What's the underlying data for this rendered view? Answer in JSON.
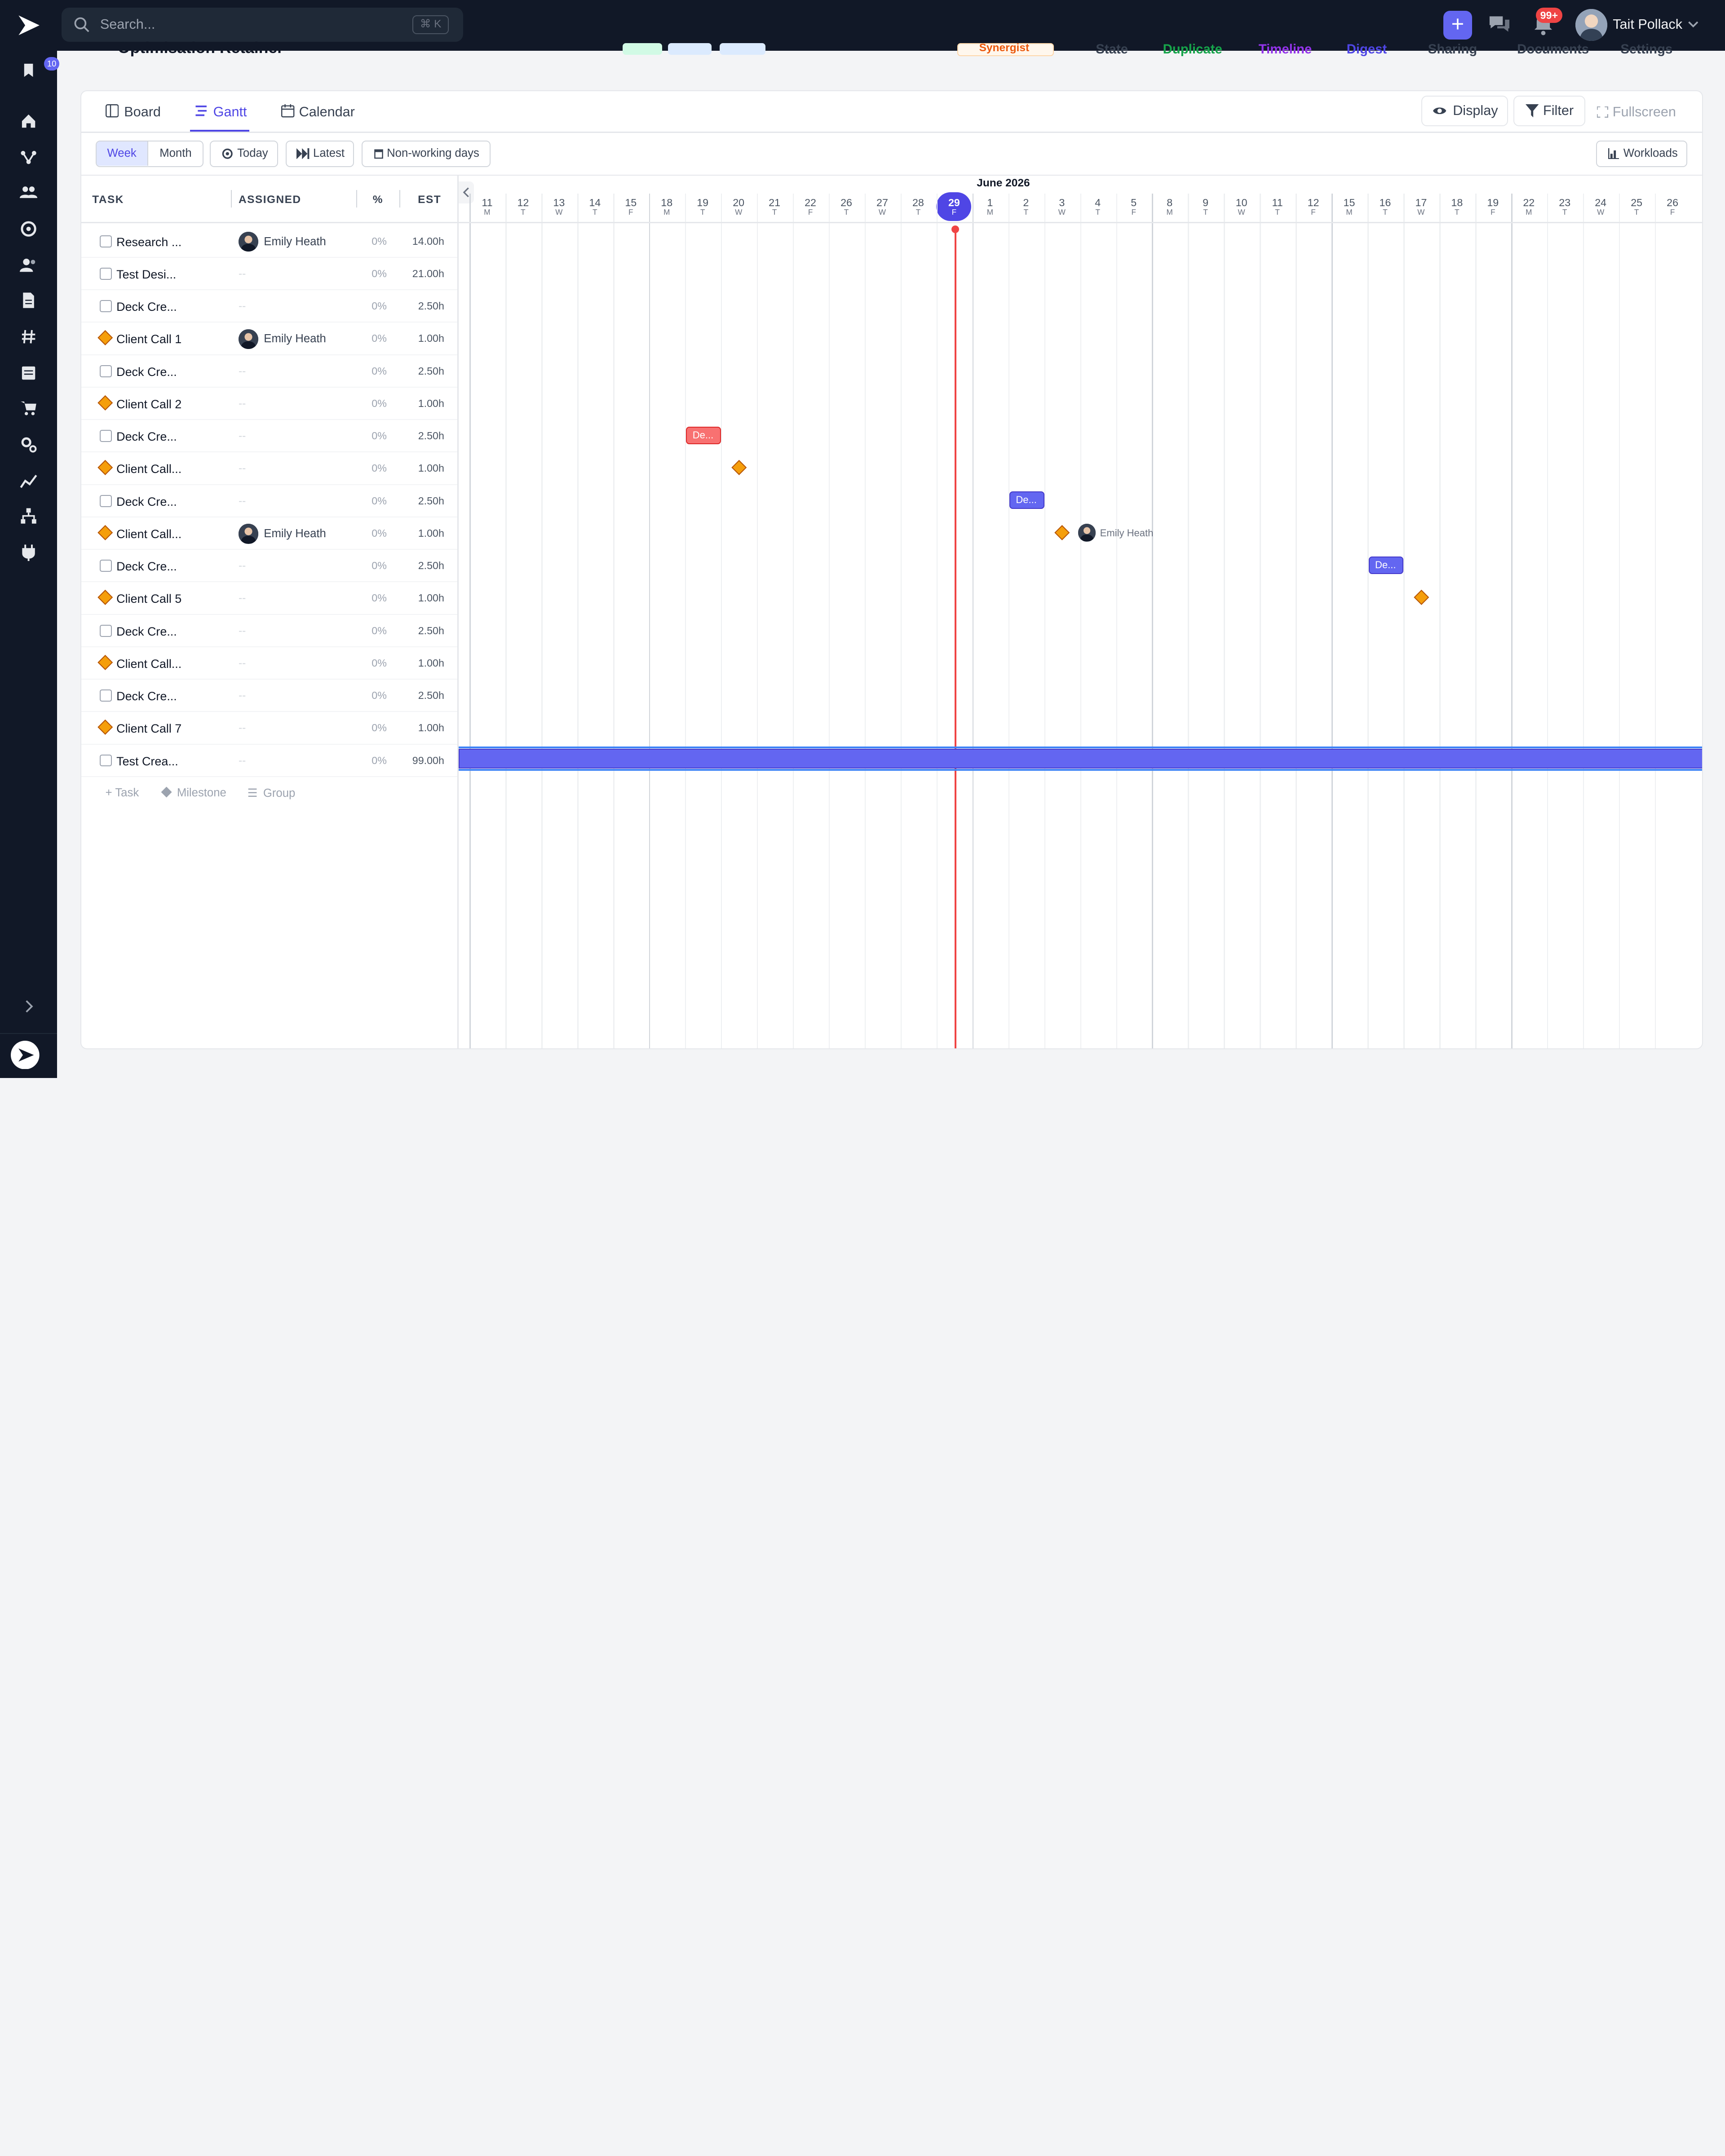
{
  "header": {
    "search_placeholder": "Search...",
    "search_shortcut": "⌘ K",
    "notification_count": "99+",
    "user_name": "Tait Pollack"
  },
  "sidebar": {
    "badge": "10"
  },
  "project": {
    "title": "Optimisation Retainer",
    "actions": [
      "State",
      "Duplicate",
      "Timeline",
      "Digest",
      "Sharing",
      "Documents",
      "Settings"
    ],
    "synergist": "Synergist"
  },
  "tabs": [
    "Board",
    "Gantt",
    "Calendar"
  ],
  "actions": {
    "display": "Display",
    "filter": "Filter",
    "fullscreen": "Fullscreen",
    "workloads": "Workloads"
  },
  "toolbar": {
    "week": "Week",
    "month": "Month",
    "today": "Today",
    "latest": "Latest",
    "nonworking": "Non-working days"
  },
  "columns": {
    "task": "TASK",
    "assigned": "ASSIGNED",
    "percent": "%",
    "est": "EST"
  },
  "tasks": [
    {
      "name": "Research ...",
      "type": "task",
      "assignee": "Emily Heath",
      "pct": "0%",
      "est": "14.00h"
    },
    {
      "name": "Test Desi...",
      "type": "task",
      "assignee": "--",
      "pct": "0%",
      "est": "21.00h"
    },
    {
      "name": "Deck Cre...",
      "type": "task",
      "assignee": "--",
      "pct": "0%",
      "est": "2.50h"
    },
    {
      "name": "Client Call 1",
      "type": "milestone",
      "assignee": "Emily Heath",
      "pct": "0%",
      "est": "1.00h"
    },
    {
      "name": "Deck Cre...",
      "type": "task",
      "assignee": "--",
      "pct": "0%",
      "est": "2.50h"
    },
    {
      "name": "Client Call 2",
      "type": "milestone",
      "assignee": "--",
      "pct": "0%",
      "est": "1.00h"
    },
    {
      "name": "Deck Cre...",
      "type": "task",
      "assignee": "--",
      "pct": "0%",
      "est": "2.50h"
    },
    {
      "name": "Client Call...",
      "type": "milestone",
      "assignee": "--",
      "pct": "0%",
      "est": "1.00h"
    },
    {
      "name": "Deck Cre...",
      "type": "task",
      "assignee": "--",
      "pct": "0%",
      "est": "2.50h"
    },
    {
      "name": "Client Call...",
      "type": "milestone",
      "assignee": "Emily Heath",
      "pct": "0%",
      "est": "1.00h"
    },
    {
      "name": "Deck Cre...",
      "type": "task",
      "assignee": "--",
      "pct": "0%",
      "est": "2.50h"
    },
    {
      "name": "Client Call 5",
      "type": "milestone",
      "assignee": "--",
      "pct": "0%",
      "est": "1.00h"
    },
    {
      "name": "Deck Cre...",
      "type": "task",
      "assignee": "--",
      "pct": "0%",
      "est": "2.50h"
    },
    {
      "name": "Client Call...",
      "type": "milestone",
      "assignee": "--",
      "pct": "0%",
      "est": "1.00h"
    },
    {
      "name": "Deck Cre...",
      "type": "task",
      "assignee": "--",
      "pct": "0%",
      "est": "2.50h"
    },
    {
      "name": "Client Call 7",
      "type": "milestone",
      "assignee": "--",
      "pct": "0%",
      "est": "1.00h"
    },
    {
      "name": "Test Crea...",
      "type": "task",
      "assignee": "--",
      "pct": "0%",
      "est": "99.00h"
    }
  ],
  "add": {
    "task": "Task",
    "milestone": "Milestone",
    "group": "Group"
  },
  "gantt": {
    "month_label": "June 2026",
    "days": [
      {
        "d": "11",
        "w": "M"
      },
      {
        "d": "12",
        "w": "T"
      },
      {
        "d": "13",
        "w": "W"
      },
      {
        "d": "14",
        "w": "T"
      },
      {
        "d": "15",
        "w": "F"
      },
      {
        "d": "18",
        "w": "M"
      },
      {
        "d": "19",
        "w": "T"
      },
      {
        "d": "20",
        "w": "W"
      },
      {
        "d": "21",
        "w": "T"
      },
      {
        "d": "22",
        "w": "F"
      },
      {
        "d": "26",
        "w": "T"
      },
      {
        "d": "27",
        "w": "W"
      },
      {
        "d": "28",
        "w": "T"
      },
      {
        "d": "29",
        "w": "F"
      },
      {
        "d": "1",
        "w": "M"
      },
      {
        "d": "2",
        "w": "T"
      },
      {
        "d": "3",
        "w": "W"
      },
      {
        "d": "4",
        "w": "T"
      },
      {
        "d": "5",
        "w": "F"
      },
      {
        "d": "8",
        "w": "M"
      },
      {
        "d": "9",
        "w": "T"
      },
      {
        "d": "10",
        "w": "W"
      },
      {
        "d": "11",
        "w": "T"
      },
      {
        "d": "12",
        "w": "F"
      },
      {
        "d": "15",
        "w": "M"
      },
      {
        "d": "16",
        "w": "T"
      },
      {
        "d": "17",
        "w": "W"
      },
      {
        "d": "18",
        "w": "T"
      },
      {
        "d": "19",
        "w": "F"
      },
      {
        "d": "22",
        "w": "M"
      },
      {
        "d": "23",
        "w": "T"
      },
      {
        "d": "24",
        "w": "W"
      },
      {
        "d": "25",
        "w": "T"
      },
      {
        "d": "26",
        "w": "F"
      }
    ],
    "bar_label": "De...",
    "assignee_label": "Emily Heath",
    "colors": {
      "overdue": "#f87171",
      "planned": "#6366f1",
      "milestone": "#f59e0b",
      "today": "#ef4444"
    }
  }
}
